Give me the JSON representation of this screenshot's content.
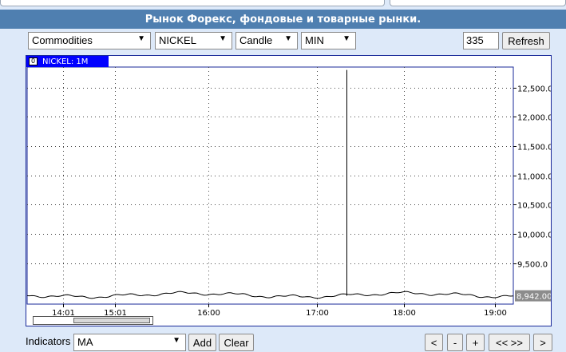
{
  "banner": {
    "title": "Рынок Форекс, фондовые и товарные рынки."
  },
  "toolbar": {
    "market": "Commodities",
    "instrument": "NICKEL",
    "chart_type": "Candle",
    "period": "MIN",
    "bars_value": "335",
    "refresh_label": "Refresh"
  },
  "chart": {
    "tab_label": "NICKEL: 1M",
    "tab_close": "0",
    "current_price": "8,942.00"
  },
  "chart_data": {
    "type": "line",
    "y_ticks": [
      "12,500.0",
      "12,000.0",
      "11,500.0",
      "11,000.0",
      "10,500.0",
      "10,000.0",
      "9,500.0"
    ],
    "y_tick_values": [
      12500,
      12000,
      11500,
      11000,
      10500,
      10000,
      9500
    ],
    "x_ticks": [
      "14:01",
      "15:01",
      "16:00",
      "17:00",
      "18:00",
      "19:00"
    ],
    "ylim": [
      8800,
      12850
    ],
    "base_level": 8942,
    "spike_value": 12800,
    "grid": true
  },
  "indicators": {
    "label": "Indicators",
    "selected": "MA",
    "add_label": "Add",
    "clear_label": "Clear"
  },
  "nav": {
    "prev": "<",
    "zoom_out": "-",
    "zoom_in": "+",
    "reset": "<< >>",
    "next": ">"
  }
}
